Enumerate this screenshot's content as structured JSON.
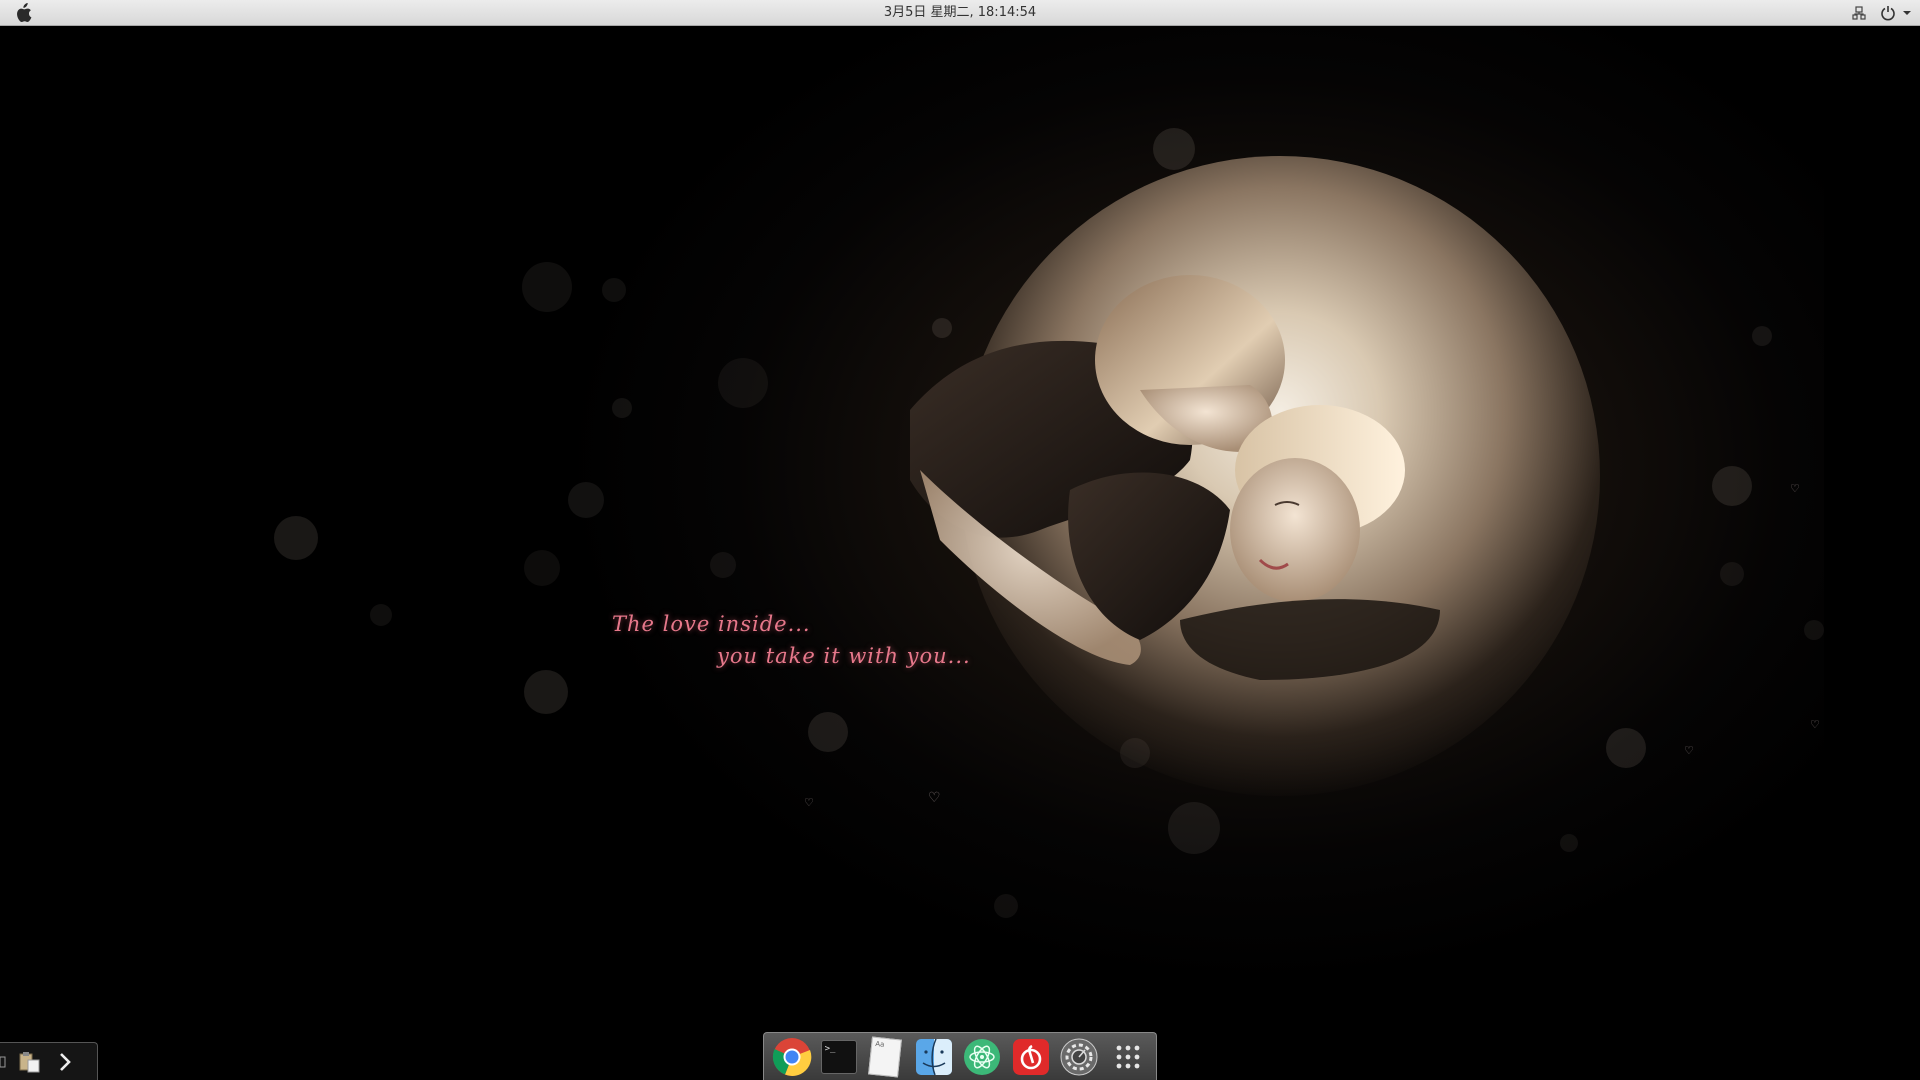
{
  "topbar": {
    "clock": "3月5日 星期二, 18:14:54",
    "apple_icon": "apple-logo-icon",
    "tray": [
      "network-icon",
      "power-icon"
    ]
  },
  "wallpaper": {
    "quote_line1": "The love inside...",
    "quote_line2": "you take it with you...",
    "quote_color": "#e7788b"
  },
  "left_panel": {
    "items": [
      "show-desktop-icon",
      "clipboard-icon",
      "expand-arrow-icon"
    ]
  },
  "dock": {
    "items": [
      {
        "name": "chrome-icon"
      },
      {
        "name": "terminal-icon",
        "text": ">_"
      },
      {
        "name": "text-editor-icon",
        "text": "Aa"
      },
      {
        "name": "finder-icon"
      },
      {
        "name": "atom-editor-icon"
      },
      {
        "name": "netease-music-icon"
      },
      {
        "name": "system-settings-icon"
      },
      {
        "name": "app-launcher-icon"
      }
    ]
  }
}
